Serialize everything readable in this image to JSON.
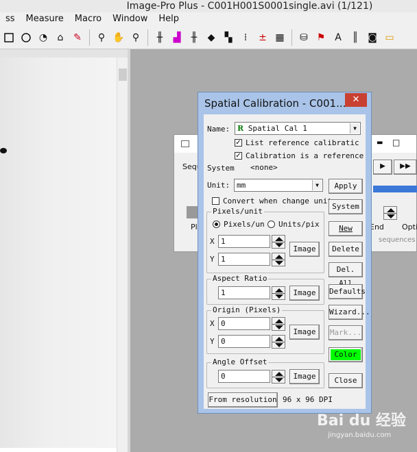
{
  "app": {
    "title": "Image-Pro Plus - C001H001S0001single.avi (1/121)"
  },
  "menu": [
    "ss",
    "Measure",
    "Macro",
    "Window",
    "Help"
  ],
  "toolbar_icons": [
    "rect-select-icon",
    "ellipse-select-icon",
    "polygon-icon",
    "magic-wand-icon",
    "pencil-icon",
    "zoom-icon",
    "hand-icon",
    "zoom-region-icon",
    "histogram-icon",
    "color-histogram-icon",
    "line-profile-icon",
    "threshold-icon",
    "grid-icon",
    "count-icon",
    "measure-icon",
    "camera-icon"
  ],
  "sequencer": {
    "label_prefix": "Seque",
    "system_label": "System",
    "pl_label": "Pl",
    "end_label": "End",
    "opti_label": "Opti",
    "sequences_label": "sequences"
  },
  "dialog": {
    "title": "Spatial Calibration - C001...",
    "close_glyph": "✕",
    "name_label": "Name:",
    "name_badge": "R",
    "name_value": "Spatial Cal 1",
    "list_ref_label": "List reference calibratic",
    "list_ref_checked": true,
    "cal_ref_label": "Calibration is a reference",
    "cal_ref_checked": true,
    "system_label": "System",
    "system_value": "<none>",
    "unit_label": "Unit:",
    "unit_value": "mm",
    "convert_label": "Convert when change unit",
    "convert_checked": false,
    "pixels_group": "Pixels/unit",
    "radio_pixels": "Pixels/un",
    "radio_units": "Units/pix",
    "x_label": "X",
    "y_label": "Y",
    "px_x": "1",
    "px_y": "1",
    "image_btn": "Image",
    "aspect_group": "Aspect Ratio",
    "aspect_value": "1",
    "origin_group": "Origin (Pixels)",
    "origin_x": "0",
    "origin_y": "0",
    "angle_group": "Angle Offset",
    "angle_value": "0",
    "from_res_btn": "From resolution",
    "dpi_text": "96 x 96 DPI",
    "buttons": {
      "apply": "Apply",
      "system": "System",
      "new": "New",
      "delete": "Delete",
      "del_all": "Del. All",
      "defaults": "Defaults",
      "wizard": "Wizard...",
      "mark": "Mark...",
      "color": "Color",
      "close": "Close"
    },
    "color_swatch": "#00ff00"
  },
  "watermark": {
    "logo": "Bai du 经验",
    "url": "jingyan.baidu.com"
  }
}
